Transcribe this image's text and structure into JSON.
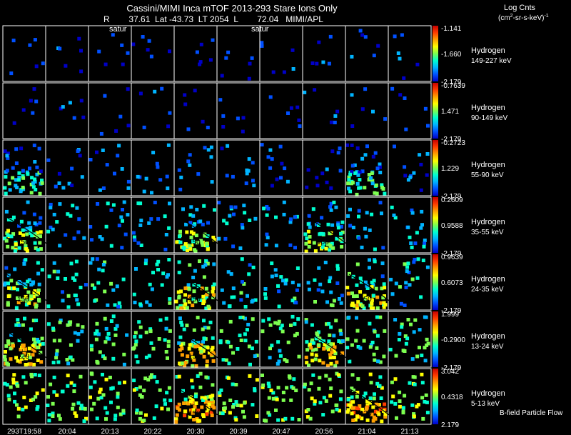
{
  "header": {
    "title": "Cassini/MIMI Inca mTOF  2013-293   Stare   Ions Only",
    "info": "R        37.61  Lat -43.73  LT 2054  L        72.04   MIMI/APL",
    "saturn_label_1": "satur",
    "saturn_label_2": "satur"
  },
  "legend": {
    "title": "Log Cnts",
    "units_main": "(cm",
    "units_sup": "2",
    "units_tail": "-sr-s-keV)",
    "units_sup2": "-1"
  },
  "footer": {
    "bfield_label": "B-field Particle Flow"
  },
  "colors": {
    "scale": [
      "#0000c8",
      "#0050ff",
      "#00b4ff",
      "#00ffd0",
      "#7dff50",
      "#ffff00",
      "#ffa000",
      "#ff3c00",
      "#c80000"
    ],
    "background": "#000000",
    "grid": "#ffffff"
  },
  "chart_data": {
    "type": "heatmap",
    "xlabel": "",
    "time_ticks": [
      "293T19:58",
      "20:04",
      "20:13",
      "20:22",
      "20:30",
      "20:39",
      "20:47",
      "20:56",
      "21:04",
      "21:13"
    ],
    "panels": [
      {
        "species": "Hydrogen",
        "energy": "149-227 keV",
        "cmax": "-1.141",
        "cmid": "-1.660",
        "cmin": "-2.179",
        "activity": 0.15,
        "hot": []
      },
      {
        "species": "Hydrogen",
        "energy": "90-149 keV",
        "cmax": "-0.7639",
        "cmid": "1.471",
        "cmin": "-2.179",
        "activity": 0.15,
        "hot": []
      },
      {
        "species": "Hydrogen",
        "energy": "55-90 keV",
        "cmax": "-0.2723",
        "cmid": "1.229",
        "cmin": "-2.179",
        "activity": 0.3,
        "hot": [
          0,
          8
        ]
      },
      {
        "species": "Hydrogen",
        "energy": "35-55 keV",
        "cmax": "0.2609",
        "cmid": "0.9588",
        "cmin": "-2.179",
        "activity": 0.45,
        "hot": [
          0,
          4,
          7
        ],
        "contour": [
          "150",
          "150",
          "150"
        ]
      },
      {
        "species": "Hydrogen",
        "energy": "24-35 keV",
        "cmax": "0.9639",
        "cmid": "0.6073",
        "cmin": "-2.179",
        "activity": 0.55,
        "hot": [
          0,
          4,
          8
        ],
        "contour": [
          "150",
          "150",
          "150"
        ]
      },
      {
        "species": "Hydrogen",
        "energy": "13-24 keV",
        "cmax": "1.999",
        "cmid": "-0.2900",
        "cmin": "-2.179",
        "activity": 0.7,
        "hot": [
          0,
          4,
          7
        ],
        "contour": [
          "120",
          "150",
          "150"
        ]
      },
      {
        "species": "Hydrogen",
        "energy": "5-13 keV",
        "cmax": "3.042",
        "cmid": "0.4318",
        "cmin": "2.179",
        "activity": 0.8,
        "hot": [
          4,
          8
        ],
        "contour": [
          "150",
          "120"
        ]
      }
    ]
  }
}
